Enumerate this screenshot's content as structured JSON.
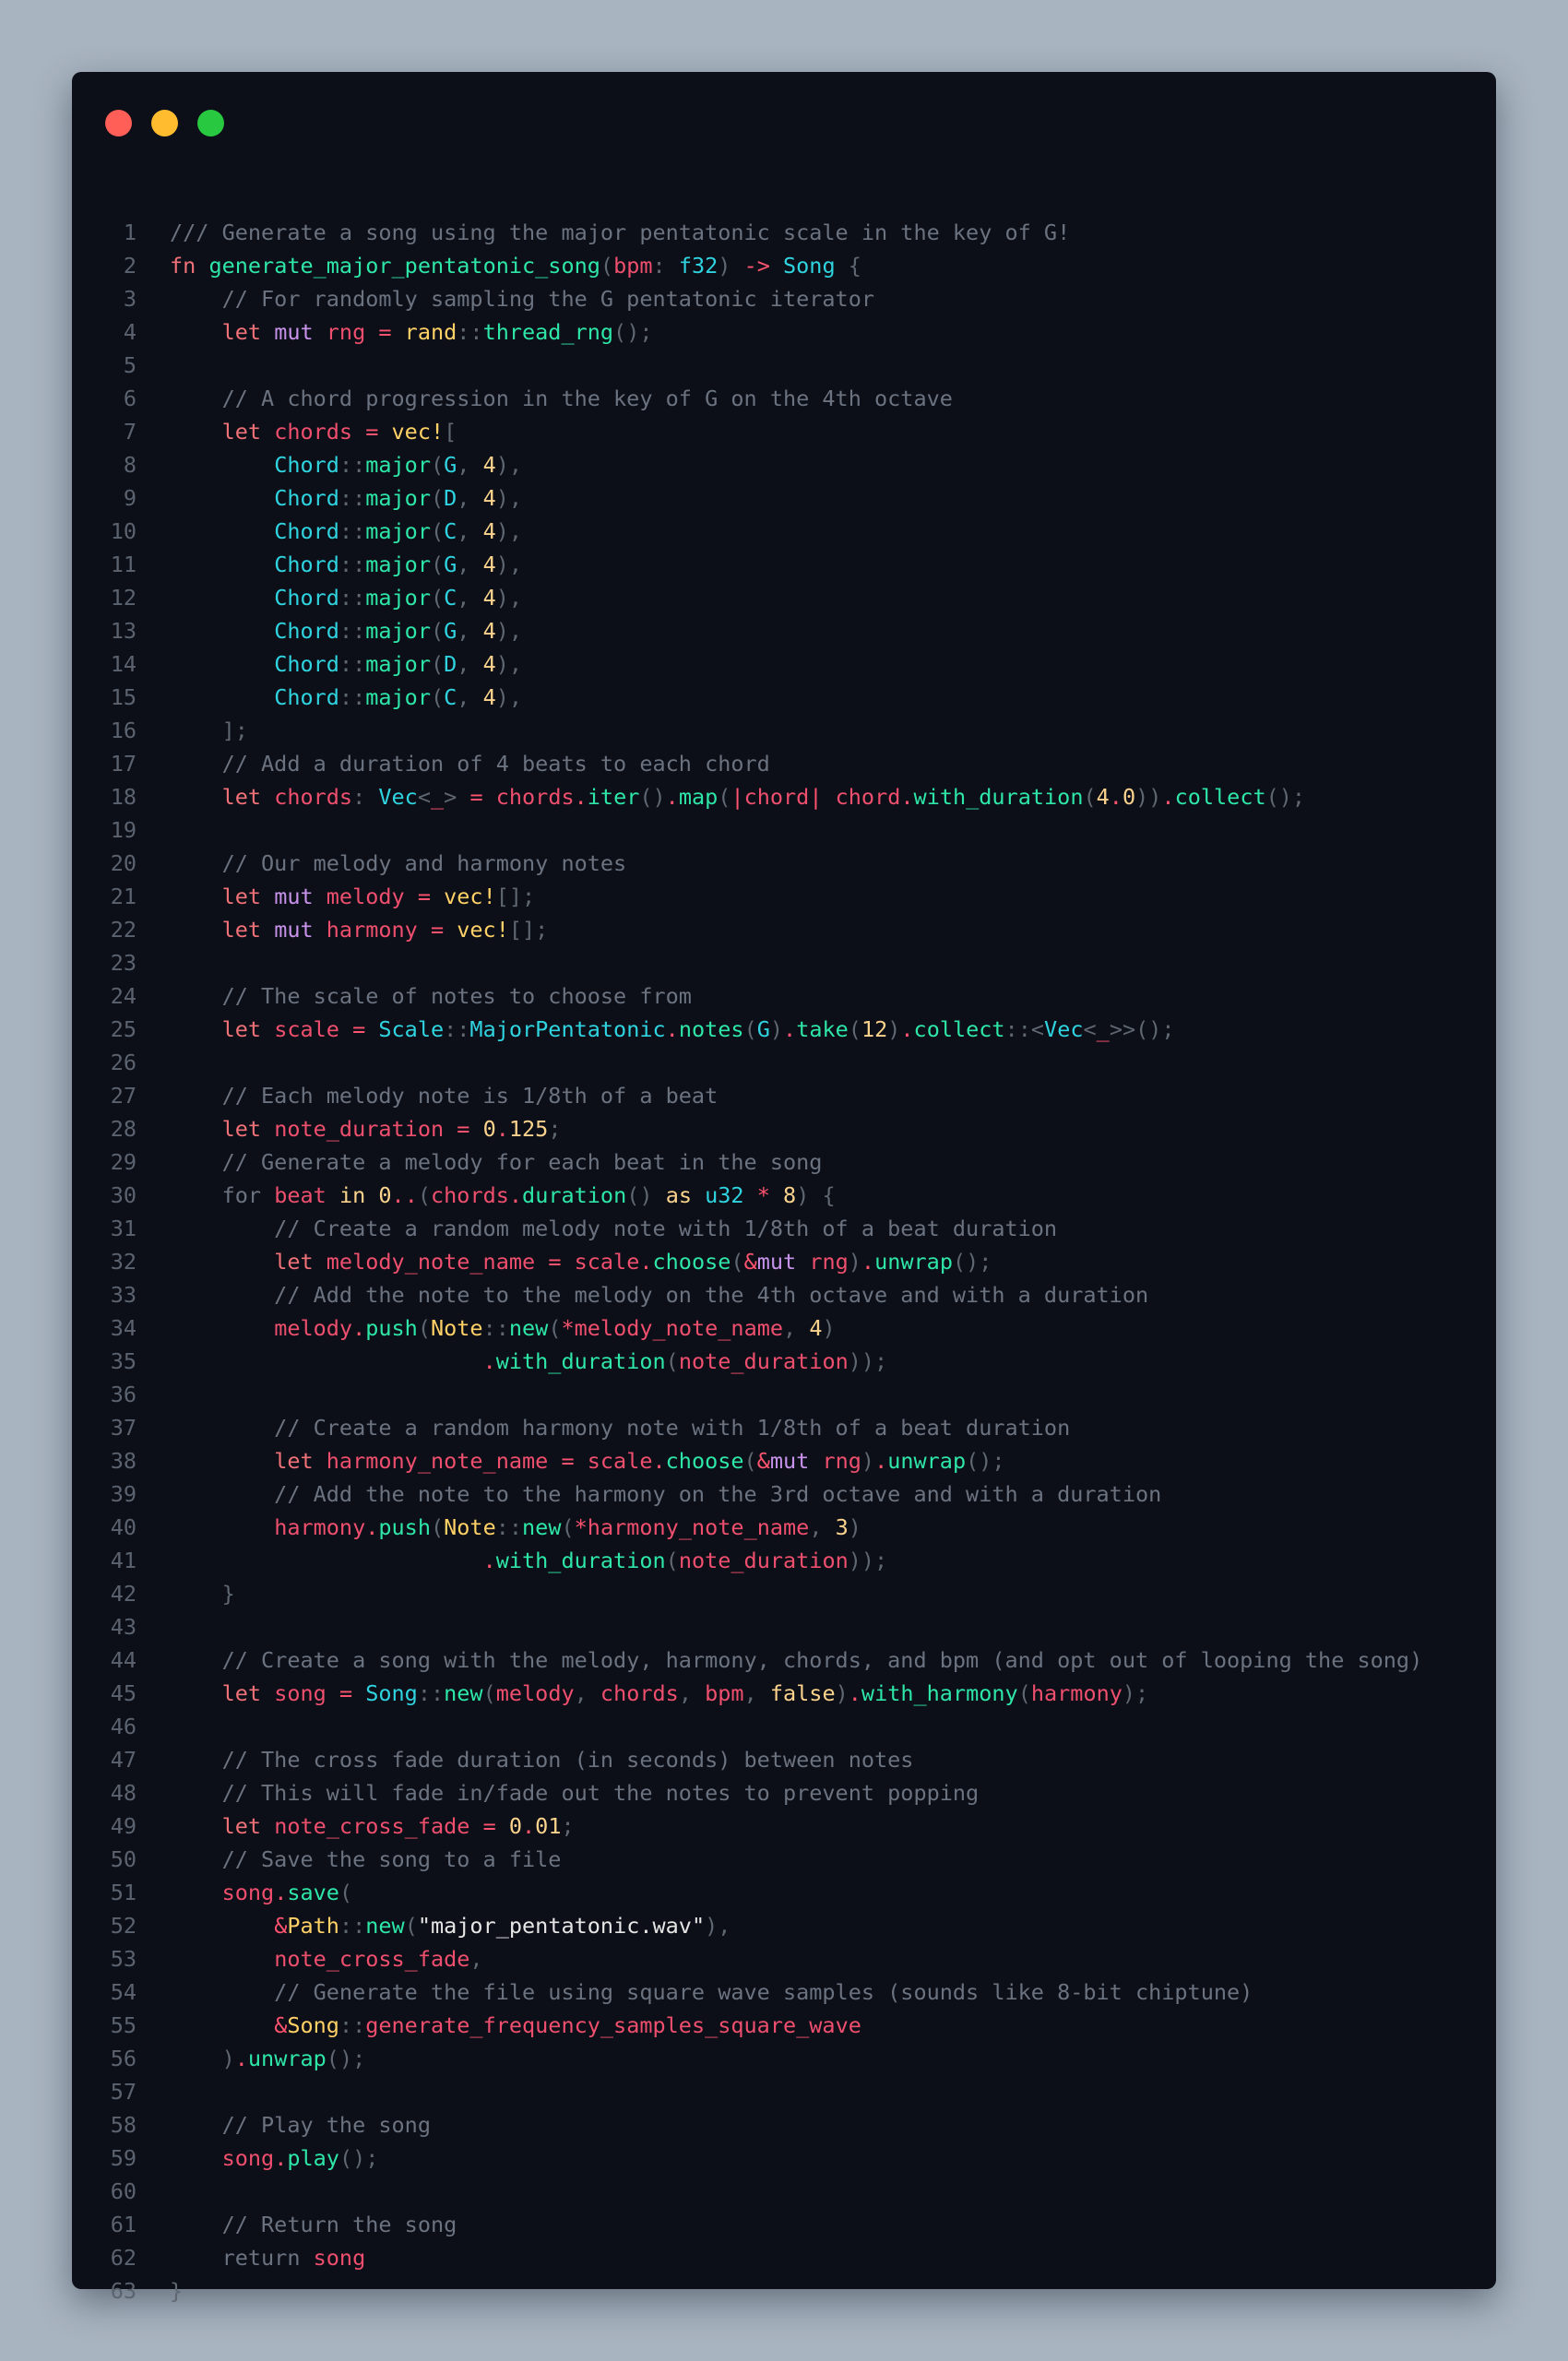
{
  "window": {
    "controls": [
      {
        "name": "close",
        "color": "#ff5f57"
      },
      {
        "name": "minimize",
        "color": "#febc2e"
      },
      {
        "name": "maximize",
        "color": "#28c840"
      }
    ]
  },
  "colors": {
    "cm": "#6b7280",
    "kw": "#f07178",
    "md": "#c792ea",
    "fn": "#2ee6a8",
    "ty": "#2fd4e0",
    "nm": "#fbd38d",
    "pl": "#e6e6e6",
    "pu": "#5f6773",
    "vr": "#ef4f6e",
    "op": "#ff5370",
    "mc": "#ffd166",
    "sn": "#e6e6e6",
    "bl": "#fbd38d"
  },
  "code": [
    [
      [
        "cm",
        "/// Generate a song using the major pentatonic scale in the key of G!"
      ]
    ],
    [
      [
        "kw",
        "fn "
      ],
      [
        "fn",
        "generate_major_pentatonic_song"
      ],
      [
        "pu",
        "("
      ],
      [
        "vr",
        "bpm"
      ],
      [
        "pu",
        ": "
      ],
      [
        "ty",
        "f32"
      ],
      [
        "pu",
        ") "
      ],
      [
        "op",
        "-> "
      ],
      [
        "ty",
        "Song "
      ],
      [
        "pu",
        "{"
      ]
    ],
    [
      [
        "cm",
        "    // For randomly sampling the G pentatonic iterator"
      ]
    ],
    [
      [
        "pl",
        "    "
      ],
      [
        "kw",
        "let "
      ],
      [
        "md",
        "mut "
      ],
      [
        "vr",
        "rng "
      ],
      [
        "op",
        "= "
      ],
      [
        "mc",
        "rand"
      ],
      [
        "pu",
        "::"
      ],
      [
        "fn",
        "thread_rng"
      ],
      [
        "pu",
        "();"
      ]
    ],
    [],
    [
      [
        "cm",
        "    // A chord progression in the key of G on the 4th octave"
      ]
    ],
    [
      [
        "pl",
        "    "
      ],
      [
        "kw",
        "let "
      ],
      [
        "vr",
        "chords "
      ],
      [
        "op",
        "= "
      ],
      [
        "mc",
        "vec!"
      ],
      [
        "pu",
        "["
      ]
    ],
    [
      [
        "pl",
        "        "
      ],
      [
        "ty",
        "Chord"
      ],
      [
        "pu",
        "::"
      ],
      [
        "fn",
        "major"
      ],
      [
        "pu",
        "("
      ],
      [
        "ty",
        "G"
      ],
      [
        "pu",
        ", "
      ],
      [
        "nm",
        "4"
      ],
      [
        "pu",
        "),"
      ]
    ],
    [
      [
        "pl",
        "        "
      ],
      [
        "ty",
        "Chord"
      ],
      [
        "pu",
        "::"
      ],
      [
        "fn",
        "major"
      ],
      [
        "pu",
        "("
      ],
      [
        "ty",
        "D"
      ],
      [
        "pu",
        ", "
      ],
      [
        "nm",
        "4"
      ],
      [
        "pu",
        "),"
      ]
    ],
    [
      [
        "pl",
        "        "
      ],
      [
        "ty",
        "Chord"
      ],
      [
        "pu",
        "::"
      ],
      [
        "fn",
        "major"
      ],
      [
        "pu",
        "("
      ],
      [
        "ty",
        "C"
      ],
      [
        "pu",
        ", "
      ],
      [
        "nm",
        "4"
      ],
      [
        "pu",
        "),"
      ]
    ],
    [
      [
        "pl",
        "        "
      ],
      [
        "ty",
        "Chord"
      ],
      [
        "pu",
        "::"
      ],
      [
        "fn",
        "major"
      ],
      [
        "pu",
        "("
      ],
      [
        "ty",
        "G"
      ],
      [
        "pu",
        ", "
      ],
      [
        "nm",
        "4"
      ],
      [
        "pu",
        "),"
      ]
    ],
    [
      [
        "pl",
        "        "
      ],
      [
        "ty",
        "Chord"
      ],
      [
        "pu",
        "::"
      ],
      [
        "fn",
        "major"
      ],
      [
        "pu",
        "("
      ],
      [
        "ty",
        "C"
      ],
      [
        "pu",
        ", "
      ],
      [
        "nm",
        "4"
      ],
      [
        "pu",
        "),"
      ]
    ],
    [
      [
        "pl",
        "        "
      ],
      [
        "ty",
        "Chord"
      ],
      [
        "pu",
        "::"
      ],
      [
        "fn",
        "major"
      ],
      [
        "pu",
        "("
      ],
      [
        "ty",
        "G"
      ],
      [
        "pu",
        ", "
      ],
      [
        "nm",
        "4"
      ],
      [
        "pu",
        "),"
      ]
    ],
    [
      [
        "pl",
        "        "
      ],
      [
        "ty",
        "Chord"
      ],
      [
        "pu",
        "::"
      ],
      [
        "fn",
        "major"
      ],
      [
        "pu",
        "("
      ],
      [
        "ty",
        "D"
      ],
      [
        "pu",
        ", "
      ],
      [
        "nm",
        "4"
      ],
      [
        "pu",
        "),"
      ]
    ],
    [
      [
        "pl",
        "        "
      ],
      [
        "ty",
        "Chord"
      ],
      [
        "pu",
        "::"
      ],
      [
        "fn",
        "major"
      ],
      [
        "pu",
        "("
      ],
      [
        "ty",
        "C"
      ],
      [
        "pu",
        ", "
      ],
      [
        "nm",
        "4"
      ],
      [
        "pu",
        "),"
      ]
    ],
    [
      [
        "pu",
        "    ];"
      ]
    ],
    [
      [
        "cm",
        "    // Add a duration of 4 beats to each chord"
      ]
    ],
    [
      [
        "pl",
        "    "
      ],
      [
        "kw",
        "let "
      ],
      [
        "vr",
        "chords"
      ],
      [
        "pu",
        ": "
      ],
      [
        "ty",
        "Vec"
      ],
      [
        "pu",
        "<"
      ],
      [
        "op",
        "_"
      ],
      [
        "pu",
        "> "
      ],
      [
        "op",
        "= "
      ],
      [
        "vr",
        "chords"
      ],
      [
        "op",
        "."
      ],
      [
        "fn",
        "iter"
      ],
      [
        "pu",
        "()"
      ],
      [
        "op",
        "."
      ],
      [
        "fn",
        "map"
      ],
      [
        "pu",
        "("
      ],
      [
        "op",
        "|"
      ],
      [
        "vr",
        "chord"
      ],
      [
        "op",
        "| "
      ],
      [
        "vr",
        "chord"
      ],
      [
        "op",
        "."
      ],
      [
        "fn",
        "with_duration"
      ],
      [
        "pu",
        "("
      ],
      [
        "nm",
        "4"
      ],
      [
        "op",
        "."
      ],
      [
        "nm",
        "0"
      ],
      [
        "pu",
        ")"
      ],
      [
        "pu",
        ")"
      ],
      [
        "op",
        "."
      ],
      [
        "fn",
        "collect"
      ],
      [
        "pu",
        "();"
      ]
    ],
    [],
    [
      [
        "cm",
        "    // Our melody and harmony notes"
      ]
    ],
    [
      [
        "pl",
        "    "
      ],
      [
        "kw",
        "let "
      ],
      [
        "md",
        "mut "
      ],
      [
        "vr",
        "melody "
      ],
      [
        "op",
        "= "
      ],
      [
        "mc",
        "vec!"
      ],
      [
        "pu",
        "[];"
      ]
    ],
    [
      [
        "pl",
        "    "
      ],
      [
        "kw",
        "let "
      ],
      [
        "md",
        "mut "
      ],
      [
        "vr",
        "harmony "
      ],
      [
        "op",
        "= "
      ],
      [
        "mc",
        "vec!"
      ],
      [
        "pu",
        "[];"
      ]
    ],
    [],
    [
      [
        "cm",
        "    // The scale of notes to choose from"
      ]
    ],
    [
      [
        "pl",
        "    "
      ],
      [
        "kw",
        "let "
      ],
      [
        "vr",
        "scale "
      ],
      [
        "op",
        "= "
      ],
      [
        "ty",
        "Scale"
      ],
      [
        "pu",
        "::"
      ],
      [
        "ty",
        "MajorPentatonic"
      ],
      [
        "op",
        "."
      ],
      [
        "fn",
        "notes"
      ],
      [
        "pu",
        "("
      ],
      [
        "ty",
        "G"
      ],
      [
        "pu",
        ")"
      ],
      [
        "op",
        "."
      ],
      [
        "fn",
        "take"
      ],
      [
        "pu",
        "("
      ],
      [
        "nm",
        "12"
      ],
      [
        "pu",
        ")"
      ],
      [
        "op",
        "."
      ],
      [
        "fn",
        "collect"
      ],
      [
        "pu",
        "::<"
      ],
      [
        "ty",
        "Vec"
      ],
      [
        "pu",
        "<"
      ],
      [
        "op",
        "_"
      ],
      [
        "pu",
        ">>();"
      ]
    ],
    [],
    [
      [
        "cm",
        "    // Each melody note is 1/8th of a beat"
      ]
    ],
    [
      [
        "pl",
        "    "
      ],
      [
        "kw",
        "let "
      ],
      [
        "vr",
        "note_duration "
      ],
      [
        "op",
        "= "
      ],
      [
        "nm",
        "0"
      ],
      [
        "op",
        "."
      ],
      [
        "nm",
        "125"
      ],
      [
        "pu",
        ";"
      ]
    ],
    [
      [
        "cm",
        "    // Generate a melody for each beat in the song"
      ]
    ],
    [
      [
        "pl",
        "    "
      ],
      [
        "cm",
        "for "
      ],
      [
        "vr",
        "beat "
      ],
      [
        "bl",
        "in "
      ],
      [
        "nm",
        "0"
      ],
      [
        "op",
        ".."
      ],
      [
        "pu",
        "("
      ],
      [
        "vr",
        "chords"
      ],
      [
        "op",
        "."
      ],
      [
        "fn",
        "duration"
      ],
      [
        "pu",
        "() "
      ],
      [
        "bl",
        "as "
      ],
      [
        "ty",
        "u32 "
      ],
      [
        "op",
        "* "
      ],
      [
        "nm",
        "8"
      ],
      [
        "pu",
        ") {"
      ]
    ],
    [
      [
        "cm",
        "        // Create a random melody note with 1/8th of a beat duration"
      ]
    ],
    [
      [
        "pl",
        "        "
      ],
      [
        "kw",
        "let "
      ],
      [
        "vr",
        "melody_note_name "
      ],
      [
        "op",
        "= "
      ],
      [
        "vr",
        "scale"
      ],
      [
        "op",
        "."
      ],
      [
        "fn",
        "choose"
      ],
      [
        "pu",
        "("
      ],
      [
        "op",
        "&"
      ],
      [
        "md",
        "mut "
      ],
      [
        "vr",
        "rng"
      ],
      [
        "pu",
        ")"
      ],
      [
        "op",
        "."
      ],
      [
        "fn",
        "unwrap"
      ],
      [
        "pu",
        "();"
      ]
    ],
    [
      [
        "cm",
        "        // Add the note to the melody on the 4th octave and with a duration"
      ]
    ],
    [
      [
        "pl",
        "        "
      ],
      [
        "vr",
        "melody"
      ],
      [
        "op",
        "."
      ],
      [
        "fn",
        "push"
      ],
      [
        "pu",
        "("
      ],
      [
        "mc",
        "Note"
      ],
      [
        "pu",
        "::"
      ],
      [
        "fn",
        "new"
      ],
      [
        "pu",
        "("
      ],
      [
        "op",
        "*"
      ],
      [
        "vr",
        "melody_note_name"
      ],
      [
        "pu",
        ", "
      ],
      [
        "nm",
        "4"
      ],
      [
        "pu",
        ")"
      ]
    ],
    [
      [
        "pl",
        "                        "
      ],
      [
        "op",
        "."
      ],
      [
        "fn",
        "with_duration"
      ],
      [
        "pu",
        "("
      ],
      [
        "vr",
        "note_duration"
      ],
      [
        "pu",
        "));"
      ]
    ],
    [],
    [
      [
        "cm",
        "        // Create a random harmony note with 1/8th of a beat duration"
      ]
    ],
    [
      [
        "pl",
        "        "
      ],
      [
        "kw",
        "let "
      ],
      [
        "vr",
        "harmony_note_name "
      ],
      [
        "op",
        "= "
      ],
      [
        "vr",
        "scale"
      ],
      [
        "op",
        "."
      ],
      [
        "fn",
        "choose"
      ],
      [
        "pu",
        "("
      ],
      [
        "op",
        "&"
      ],
      [
        "md",
        "mut "
      ],
      [
        "vr",
        "rng"
      ],
      [
        "pu",
        ")"
      ],
      [
        "op",
        "."
      ],
      [
        "fn",
        "unwrap"
      ],
      [
        "pu",
        "();"
      ]
    ],
    [
      [
        "cm",
        "        // Add the note to the harmony on the 3rd octave and with a duration"
      ]
    ],
    [
      [
        "pl",
        "        "
      ],
      [
        "vr",
        "harmony"
      ],
      [
        "op",
        "."
      ],
      [
        "fn",
        "push"
      ],
      [
        "pu",
        "("
      ],
      [
        "mc",
        "Note"
      ],
      [
        "pu",
        "::"
      ],
      [
        "fn",
        "new"
      ],
      [
        "pu",
        "("
      ],
      [
        "op",
        "*"
      ],
      [
        "vr",
        "harmony_note_name"
      ],
      [
        "pu",
        ", "
      ],
      [
        "nm",
        "3"
      ],
      [
        "pu",
        ")"
      ]
    ],
    [
      [
        "pl",
        "                        "
      ],
      [
        "op",
        "."
      ],
      [
        "fn",
        "with_duration"
      ],
      [
        "pu",
        "("
      ],
      [
        "vr",
        "note_duration"
      ],
      [
        "pu",
        "));"
      ]
    ],
    [
      [
        "pu",
        "    }"
      ]
    ],
    [],
    [
      [
        "cm",
        "    // Create a song with the melody, harmony, chords, and bpm (and opt out of looping the song)"
      ]
    ],
    [
      [
        "pl",
        "    "
      ],
      [
        "kw",
        "let "
      ],
      [
        "vr",
        "song "
      ],
      [
        "op",
        "= "
      ],
      [
        "ty",
        "Song"
      ],
      [
        "pu",
        "::"
      ],
      [
        "fn",
        "new"
      ],
      [
        "pu",
        "("
      ],
      [
        "vr",
        "melody"
      ],
      [
        "pu",
        ", "
      ],
      [
        "vr",
        "chords"
      ],
      [
        "pu",
        ", "
      ],
      [
        "vr",
        "bpm"
      ],
      [
        "pu",
        ", "
      ],
      [
        "bl",
        "false"
      ],
      [
        "pu",
        ")"
      ],
      [
        "op",
        "."
      ],
      [
        "fn",
        "with_harmony"
      ],
      [
        "pu",
        "("
      ],
      [
        "vr",
        "harmony"
      ],
      [
        "pu",
        ");"
      ]
    ],
    [],
    [
      [
        "cm",
        "    // The cross fade duration (in seconds) between notes"
      ]
    ],
    [
      [
        "cm",
        "    // This will fade in/fade out the notes to prevent popping"
      ]
    ],
    [
      [
        "pl",
        "    "
      ],
      [
        "kw",
        "let "
      ],
      [
        "vr",
        "note_cross_fade "
      ],
      [
        "op",
        "= "
      ],
      [
        "nm",
        "0"
      ],
      [
        "op",
        "."
      ],
      [
        "nm",
        "01"
      ],
      [
        "pu",
        ";"
      ]
    ],
    [
      [
        "cm",
        "    // Save the song to a file"
      ]
    ],
    [
      [
        "pl",
        "    "
      ],
      [
        "vr",
        "song"
      ],
      [
        "op",
        "."
      ],
      [
        "fn",
        "save"
      ],
      [
        "pu",
        "("
      ]
    ],
    [
      [
        "pl",
        "        "
      ],
      [
        "op",
        "&"
      ],
      [
        "mc",
        "Path"
      ],
      [
        "pu",
        "::"
      ],
      [
        "fn",
        "new"
      ],
      [
        "pu",
        "("
      ],
      [
        "sn",
        "\"major_pentatonic.wav\""
      ],
      [
        "pu",
        "),"
      ]
    ],
    [
      [
        "pl",
        "        "
      ],
      [
        "vr",
        "note_cross_fade"
      ],
      [
        "pu",
        ","
      ]
    ],
    [
      [
        "cm",
        "        // Generate the file using square wave samples (sounds like 8-bit chiptune)"
      ]
    ],
    [
      [
        "pl",
        "        "
      ],
      [
        "op",
        "&"
      ],
      [
        "mc",
        "Song"
      ],
      [
        "pu",
        "::"
      ],
      [
        "vr",
        "generate_frequency_samples_square_wave"
      ]
    ],
    [
      [
        "pu",
        "    )"
      ],
      [
        "op",
        "."
      ],
      [
        "fn",
        "unwrap"
      ],
      [
        "pu",
        "();"
      ]
    ],
    [],
    [
      [
        "cm",
        "    // Play the song"
      ]
    ],
    [
      [
        "pl",
        "    "
      ],
      [
        "vr",
        "song"
      ],
      [
        "op",
        "."
      ],
      [
        "fn",
        "play"
      ],
      [
        "pu",
        "();"
      ]
    ],
    [],
    [
      [
        "cm",
        "    // Return the song"
      ]
    ],
    [
      [
        "pl",
        "    "
      ],
      [
        "cm",
        "return "
      ],
      [
        "vr",
        "song"
      ]
    ],
    [
      [
        "pu",
        "}"
      ]
    ]
  ]
}
